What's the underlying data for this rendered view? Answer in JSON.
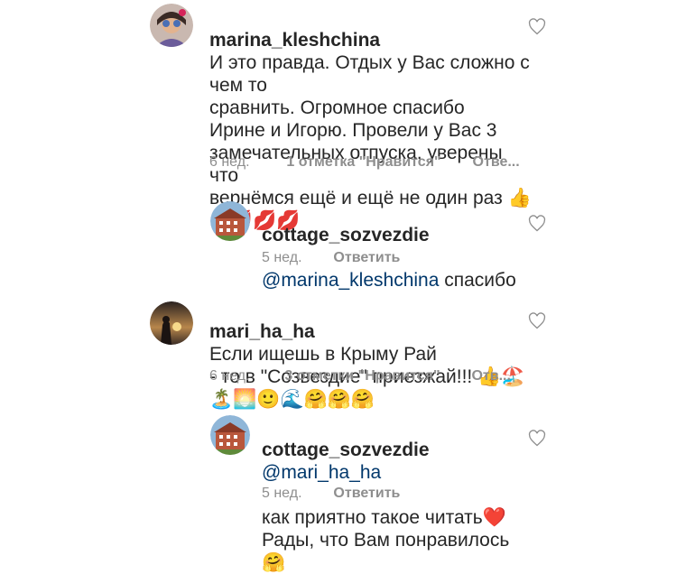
{
  "comments": [
    {
      "username": "marina_kleshchina",
      "text": "И это правда. Отдых у Вас сложно с чем то\nсравнить. Огромное спасибо\nИрине и Игорю. Провели у Вас 3\nзамечательных отпуска, уверены что\nвернёмся ещё и ещё не один раз 👍\n😉💋💋💋",
      "time": "6 нед.",
      "likes": "1 отметка \"Нравится\"",
      "reply": "Отве...",
      "avatar_icon": "user-avatar-icon"
    },
    {
      "username": "cottage_sozvezdie",
      "mention": "@marina_kleshchina",
      "text": " спасибо",
      "time": "5 нед.",
      "reply": "Ответить",
      "avatar_icon": "building-avatar-icon"
    },
    {
      "username": "mari_ha_ha",
      "text": "Если ищешь в Крыму Рай\n- то в \"Созвездие\" приезжай!!! 👍🏖️\n🏝️🌅🙂🌊🤗🤗🤗",
      "time": "6 нед.",
      "likes": "3 отметки \"Нравится\"",
      "reply": "Отв...",
      "avatar_icon": "sunset-avatar-icon"
    },
    {
      "username": "cottage_sozvezdie",
      "mention": "@mari_ha_ha",
      "text": "как приятно такое читать❤️\nРады, что Вам понравилось🤗",
      "time": "5 нед.",
      "reply": "Ответить",
      "avatar_icon": "building-avatar-icon"
    }
  ],
  "heart_icon": "heart-outline-icon"
}
